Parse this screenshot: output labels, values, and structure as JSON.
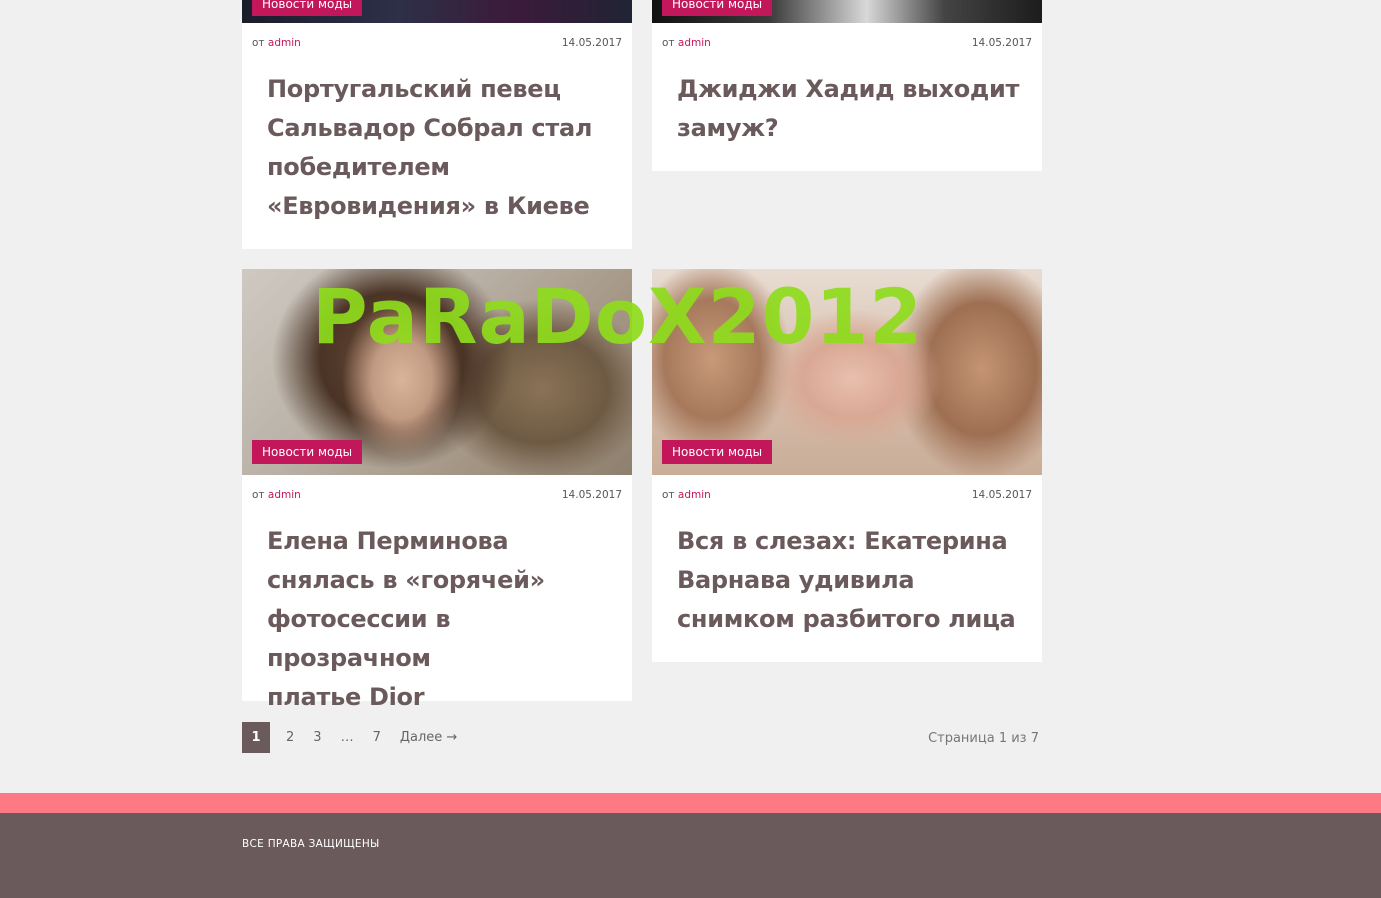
{
  "posts": [
    {
      "category": "Новости моды",
      "author_prefix": "от",
      "author": "admin",
      "date": "14.05.2017",
      "title_lines": [
        "Португальский певец",
        "Сальвадор Собрал стал",
        "победителем",
        "«Евровидения» в Киеве"
      ]
    },
    {
      "category": "Новости моды",
      "author_prefix": "от",
      "author": "admin",
      "date": "14.05.2017",
      "title_lines": [
        "Джиджи Хадид выходит",
        "замуж?"
      ]
    },
    {
      "category": "Новости моды",
      "author_prefix": "от",
      "author": "admin",
      "date": "14.05.2017",
      "title_lines": [
        "Елена Перминова",
        "снялась в «горячей»",
        "фотосессии в прозрачном",
        "платье Dior"
      ]
    },
    {
      "category": "Новости моды",
      "author_prefix": "от",
      "author": "admin",
      "date": "14.05.2017",
      "title_lines": [
        "Вся в слезах: Екатерина",
        "Варнава удивила",
        "снимком разбитого лица"
      ]
    }
  ],
  "watermark": "PaRaDoX2012",
  "pagination": {
    "pages": [
      "1",
      "2",
      "3",
      "…",
      "7"
    ],
    "next": "Далее →",
    "info": "Страница 1 из 7"
  },
  "footer": {
    "copyright": "ВСЕ ПРАВА ЗАЩИЩЕНЫ"
  },
  "colors": {
    "accent": "#c2185b",
    "footer_stripe": "#fd7a85",
    "footer_bg": "#6b5a5c",
    "watermark": "#8fdc1c"
  }
}
